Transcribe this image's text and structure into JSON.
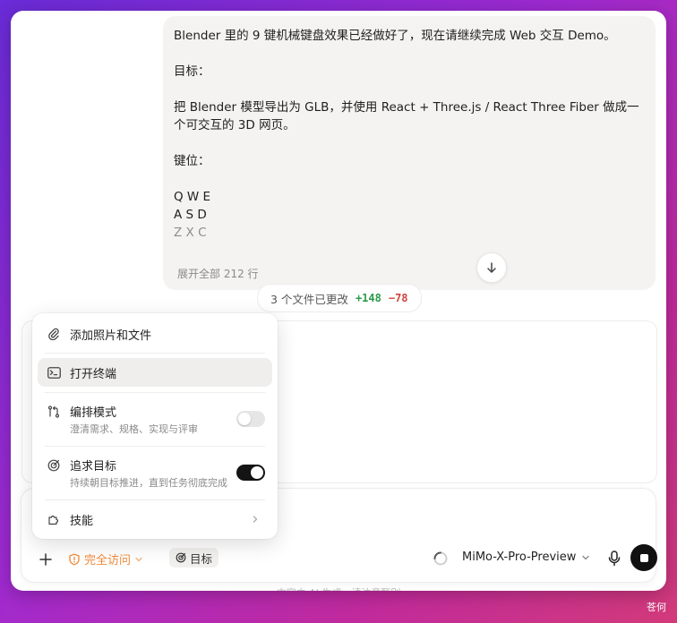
{
  "message": {
    "lines": [
      "Blender 里的 9 键机械键盘效果已经做好了，现在请继续完成 Web 交互 Demo。",
      "",
      "目标：",
      "",
      "把 Blender 模型导出为 GLB，并使用 React + Three.js / React Three Fiber 做成一个可交互的 3D 网页。",
      "",
      "键位：",
      "",
      "Q W E",
      "A S D",
      "Z X C"
    ],
    "expand_label": "展开全部 212 行"
  },
  "changes": {
    "summary": "3 个文件已更改",
    "additions": "+148",
    "deletions": "−78"
  },
  "menu": {
    "attach": "添加照片和文件",
    "terminal": "打开终端",
    "plan_mode": {
      "label": "编排模式",
      "desc": "澄清需求、规格、实现与评审",
      "enabled": false
    },
    "goal_mode": {
      "label": "追求目标",
      "desc": "持续朝目标推进，直到任务彻底完成",
      "enabled": true
    },
    "skills": "技能"
  },
  "toolbar": {
    "access": "完全访问",
    "goal_chip": "目标",
    "model": "MiMo-X-Pro-Preview"
  },
  "footer_hint": "内容由 AI 生成，请注意甄别",
  "watermark": "苍何",
  "colors": {
    "accent_orange": "#f08a3a",
    "add_green": "#2a9a49",
    "del_red": "#d0443c"
  }
}
